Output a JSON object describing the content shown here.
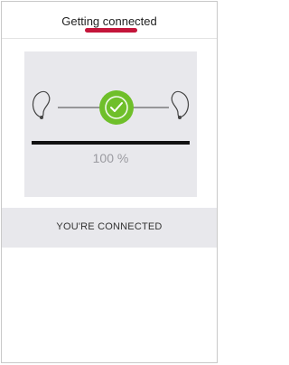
{
  "header": {
    "title": "Getting connected"
  },
  "connection": {
    "progress_percent": 100,
    "progress_label": "100 %",
    "check_color": "#6fbf2a",
    "left_device_icon": "hearing-aid-left-icon",
    "right_device_icon": "hearing-aid-right-icon",
    "status_icon": "check-circle-icon"
  },
  "status": {
    "message": "YOU'RE CONNECTED"
  },
  "colors": {
    "accent": "#c4153a",
    "panel_background": "#e8e8ec",
    "progress_bar": "#111111"
  }
}
